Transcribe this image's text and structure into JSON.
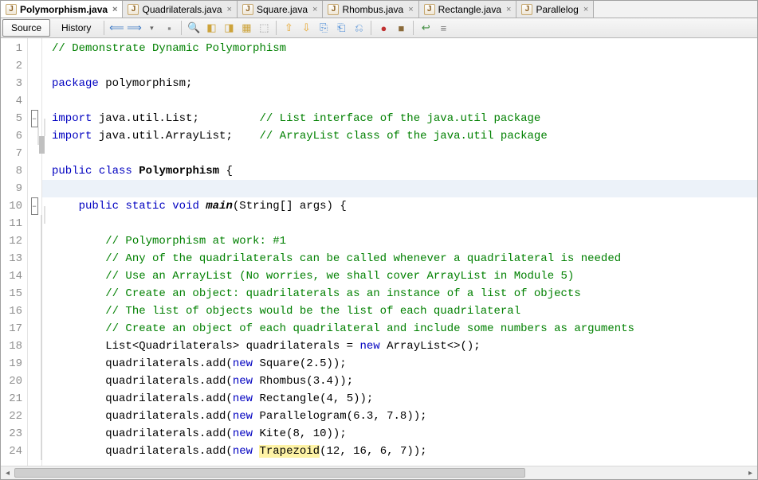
{
  "tabs": [
    {
      "label": "Polymorphism.java",
      "active": true
    },
    {
      "label": "Quadrilaterals.java",
      "active": false
    },
    {
      "label": "Square.java",
      "active": false
    },
    {
      "label": "Rhombus.java",
      "active": false
    },
    {
      "label": "Rectangle.java",
      "active": false
    },
    {
      "label": "Parallelog",
      "active": false
    }
  ],
  "subtabs": {
    "source": "Source",
    "history": "History"
  },
  "toolbar_icons": [
    "nav-back",
    "nav-fwd",
    "dropdown",
    "sep",
    "find",
    "find-prev",
    "find-next",
    "toggle-highlight",
    "toggle-bp",
    "sep",
    "shift-left",
    "shift-right",
    "format",
    "comment",
    "uncomment",
    "sep",
    "record-macro",
    "stop-macro",
    "sep",
    "wrap",
    "ruler"
  ],
  "code": [
    {
      "n": 1,
      "fold": "",
      "html": "<span class='cm'>// Demonstrate Dynamic Polymorphism</span>"
    },
    {
      "n": 2,
      "fold": "",
      "html": ""
    },
    {
      "n": 3,
      "fold": "",
      "html": "<span class='kw'>package</span> polymorphism;"
    },
    {
      "n": 4,
      "fold": "",
      "html": ""
    },
    {
      "n": 5,
      "fold": "box",
      "html": "<span class='kw'>import</span> java.util.List;         <span class='cm'>// List interface of the java.util package</span>"
    },
    {
      "n": 6,
      "fold": "end",
      "html": "<span class='kw'>import</span> java.util.ArrayList;    <span class='cm'>// ArrayList class of the java.util package</span>"
    },
    {
      "n": 7,
      "fold": "",
      "html": ""
    },
    {
      "n": 8,
      "fold": "",
      "html": "<span class='kw'>public</span> <span class='kw'>class</span> <span class='bold'>Polymorphism</span> {"
    },
    {
      "n": 9,
      "fold": "",
      "html": "",
      "hl": true
    },
    {
      "n": 10,
      "fold": "box",
      "html": "    <span class='kw'>public</span> <span class='kw'>static</span> <span class='kw'>void</span> <span class='bi'>main</span>(String[] args) {"
    },
    {
      "n": 11,
      "fold": "line",
      "html": ""
    },
    {
      "n": 12,
      "fold": "line",
      "html": "        <span class='cm'>// Polymorphism at work: #1</span>"
    },
    {
      "n": 13,
      "fold": "line",
      "html": "        <span class='cm'>// Any of the quadrilaterals can be called whenever a quadrilateral is needed</span>"
    },
    {
      "n": 14,
      "fold": "line",
      "html": "        <span class='cm'>// Use an ArrayList (No worries, we shall cover ArrayList in Module 5)</span>"
    },
    {
      "n": 15,
      "fold": "line",
      "html": "        <span class='cm'>// Create an object: quadrilaterals as an instance of a list of objects</span>"
    },
    {
      "n": 16,
      "fold": "line",
      "html": "        <span class='cm'>// The list of objects would be the list of each quadrilateral</span>"
    },
    {
      "n": 17,
      "fold": "line",
      "html": "        <span class='cm'>// Create an object of each quadrilateral and include some numbers as arguments</span>"
    },
    {
      "n": 18,
      "fold": "line",
      "html": "        List&lt;Quadrilaterals&gt; quadrilaterals = <span class='kw'>new</span> ArrayList&lt;&gt;();"
    },
    {
      "n": 19,
      "fold": "line",
      "html": "        quadrilaterals.add(<span class='kw'>new</span> Square(<span class='num'>2.5</span>));"
    },
    {
      "n": 20,
      "fold": "line",
      "html": "        quadrilaterals.add(<span class='kw'>new</span> Rhombus(<span class='num'>3.4</span>));"
    },
    {
      "n": 21,
      "fold": "line",
      "html": "        quadrilaterals.add(<span class='kw'>new</span> Rectangle(<span class='num'>4</span>, <span class='num'>5</span>));"
    },
    {
      "n": 22,
      "fold": "line",
      "html": "        quadrilaterals.add(<span class='kw'>new</span> Parallelogram(<span class='num'>6.3</span>, <span class='num'>7.8</span>));"
    },
    {
      "n": 23,
      "fold": "line",
      "html": "        quadrilaterals.add(<span class='kw'>new</span> Kite(<span class='num'>8</span>, <span class='num'>10</span>));"
    },
    {
      "n": 24,
      "fold": "line",
      "html": "        quadrilaterals.add(<span class='kw'>new</span> <span class='mark'>Trapezoid</span>(<span class='num'>12</span>, <span class='num'>16</span>, <span class='num'>6</span>, <span class='num'>7</span>));"
    }
  ]
}
